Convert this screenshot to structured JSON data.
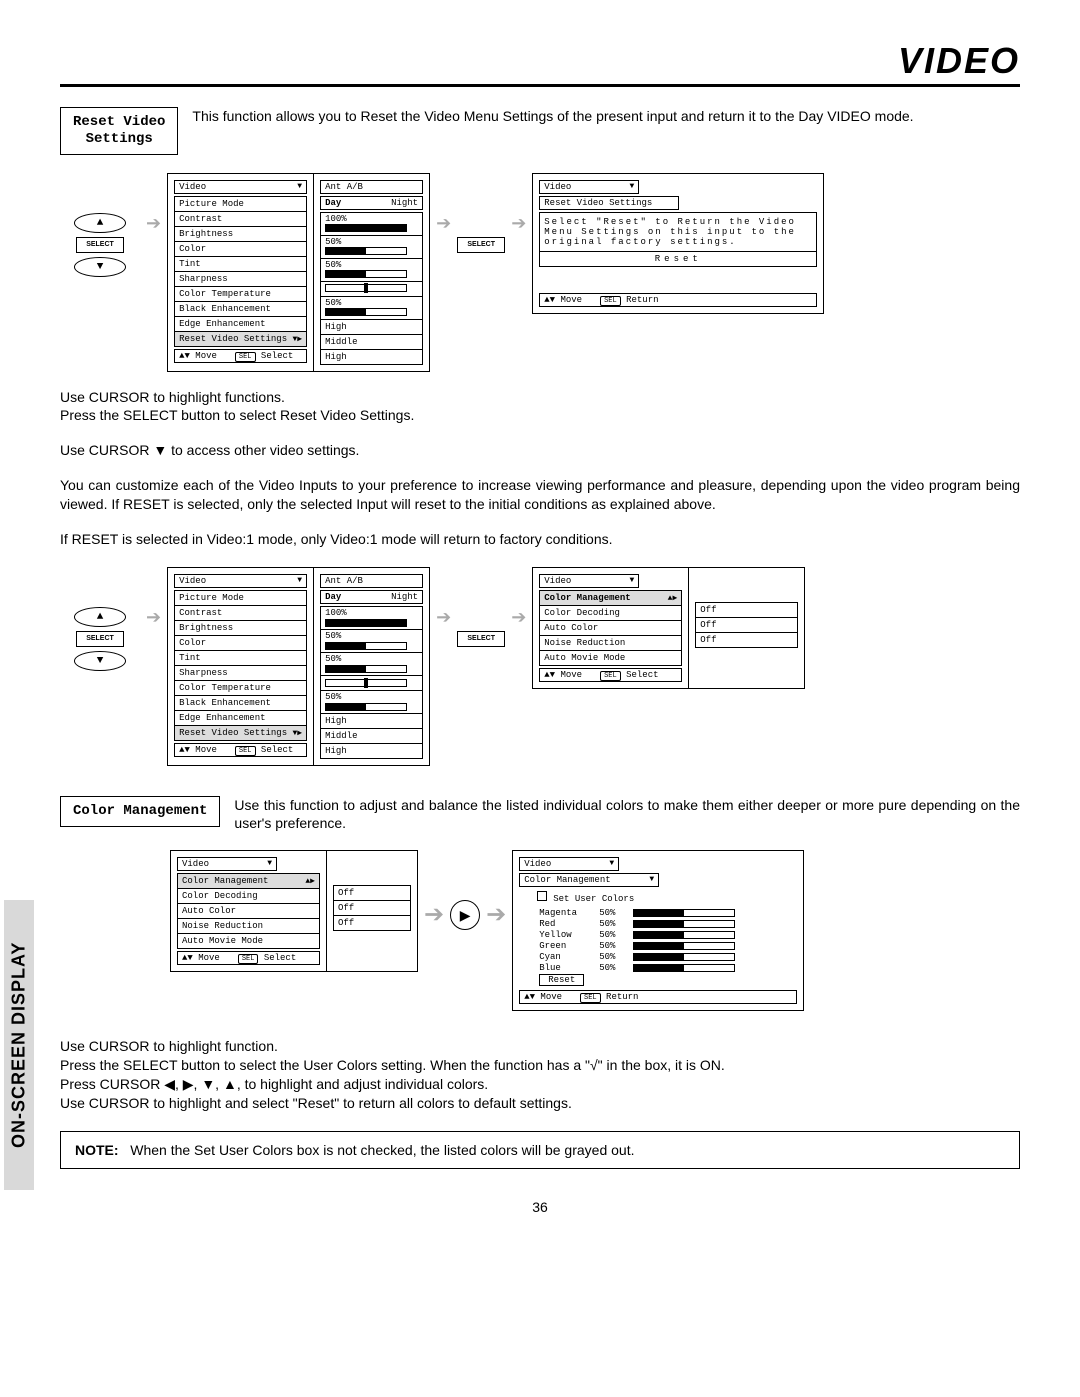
{
  "title": "VIDEO",
  "sidebar": "ON-SCREEN DISPLAY",
  "page_number": "36",
  "reset_section": {
    "label": "Reset Video\nSettings",
    "description": "This function allows you to Reset the Video Menu Settings of the present input and return it to the Day VIDEO mode."
  },
  "color_section": {
    "label": "Color Management",
    "description": "Use this function to adjust and balance the listed individual colors to make them either deeper or more pure depending on the user's preference."
  },
  "remote": {
    "select": "SELECT"
  },
  "video_menu": {
    "title": "Video",
    "input_label": "Ant A/B",
    "day": "Day",
    "night": "Night",
    "rows": [
      {
        "name": "Picture Mode"
      },
      {
        "name": "Contrast",
        "val": "100%",
        "fill": 100
      },
      {
        "name": "Brightness",
        "val": "50%",
        "fill": 50
      },
      {
        "name": "Color",
        "val": "50%",
        "fill": 50
      },
      {
        "name": "Tint",
        "thumb": 50
      },
      {
        "name": "Sharpness",
        "val": "50%",
        "fill": 50
      },
      {
        "name": "Color Temperature",
        "text": "High"
      },
      {
        "name": "Black Enhancement",
        "text": "Middle"
      },
      {
        "name": "Edge Enhancement",
        "text": "High"
      },
      {
        "name": "Reset Video Settings",
        "sel": true,
        "arrows": true
      }
    ],
    "footer": {
      "move": "▲▼ Move",
      "select": "SEL Select"
    }
  },
  "reset_panel": {
    "title": "Video",
    "sub": "Reset Video Settings",
    "message": "Select \"Reset\" to Return the Video Menu Settings on this input to the original factory settings.",
    "button": "Reset",
    "footer": {
      "move": "▲▼ Move",
      "ret": "SEL Return"
    }
  },
  "paragraphs_mid": [
    "Use CURSOR to highlight functions.",
    "Press the SELECT button to select Reset Video Settings.",
    "Use CURSOR ▼ to access other video settings.",
    "You can customize each of the Video Inputs to your preference to increase viewing performance and pleasure, depending upon the video program being viewed. If RESET is selected, only the selected Input will reset to the initial conditions as explained above.",
    "If RESET is selected in Video:1 mode, only Video:1 mode will return to factory conditions."
  ],
  "color_menu": {
    "title": "Video",
    "rows": [
      {
        "name": "Color Management",
        "sel": true,
        "arrows": true
      },
      {
        "name": "Color Decoding"
      },
      {
        "name": "Auto Color",
        "val": "Off"
      },
      {
        "name": "Noise Reduction",
        "val": "Off"
      },
      {
        "name": "Auto Movie Mode",
        "val": "Off"
      }
    ],
    "footer": {
      "move": "▲▼ Move",
      "select": "SEL Select"
    }
  },
  "user_colors": {
    "title": "Video",
    "sub": "Color Management",
    "checkbox_label": "Set User Colors",
    "colors": [
      {
        "name": "Magenta",
        "pct": "50%"
      },
      {
        "name": "Red",
        "pct": "50%"
      },
      {
        "name": "Yellow",
        "pct": "50%"
      },
      {
        "name": "Green",
        "pct": "50%"
      },
      {
        "name": "Cyan",
        "pct": "50%"
      },
      {
        "name": "Blue",
        "pct": "50%"
      }
    ],
    "reset": "Reset",
    "footer": {
      "move": "▲▼ Move",
      "ret": "SEL Return"
    }
  },
  "paragraphs_bottom": [
    "Use CURSOR to highlight function.",
    "Press the SELECT button to select the User Colors setting.  When the function has a \"√\" in the box, it is ON.",
    "Press CURSOR ◀, ▶, ▼, ▲, to highlight and adjust individual colors.",
    "Use CURSOR to highlight and select \"Reset\" to return all colors to default settings."
  ],
  "note": {
    "label": "NOTE:",
    "text": "When the Set User Colors box is not checked, the listed colors will be grayed out."
  }
}
